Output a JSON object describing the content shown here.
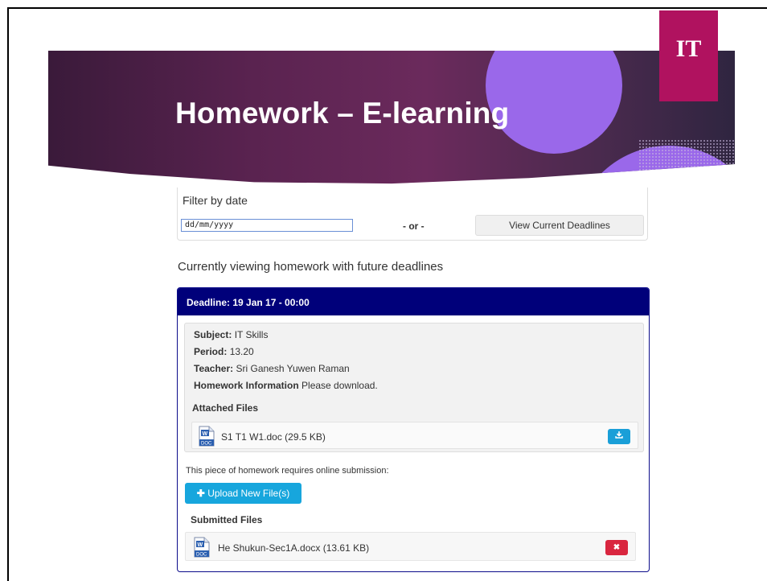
{
  "slide": {
    "title": "Homework – E-learning",
    "badge": "IT"
  },
  "filter": {
    "label": "Filter by date",
    "date_placeholder": "dd/mm/yyyy",
    "or_text": "- or -",
    "view_button": "View Current Deadlines"
  },
  "viewing_text": "Currently viewing homework with future deadlines",
  "homework": {
    "deadline": "Deadline: 19 Jan 17 - 00:00",
    "subject_label": "Subject:",
    "subject": "IT Skills",
    "period_label": "Period:",
    "period": "13.20",
    "teacher_label": "Teacher:",
    "teacher": "Sri Ganesh Yuwen Raman",
    "info_label": "Homework Information",
    "info": "Please download.",
    "attached_title": "Attached Files",
    "attached_file": "S1 T1 W1.doc (29.5 KB)",
    "submission_text": "This piece of homework requires online submission:",
    "upload_button": "Upload New File(s)",
    "submitted_title": "Submitted Files",
    "submitted_file": "He Shukun-Sec1A.docx (13.61 KB)"
  },
  "icons": {
    "download": "download-icon",
    "delete": "close-icon",
    "plus": "plus-icon",
    "doc": "word-doc-icon"
  },
  "colors": {
    "header_navy": "#00007a",
    "badge_magenta": "#b0125f",
    "accent_purple": "#9a68ea",
    "info_blue": "#17a6dd",
    "danger_red": "#d9263f"
  }
}
